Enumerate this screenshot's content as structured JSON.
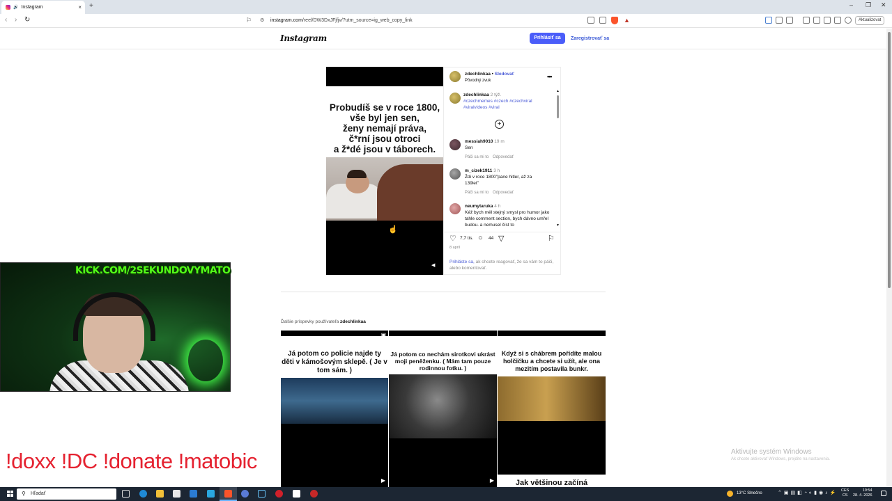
{
  "browser": {
    "tab_title": "Instagram",
    "tab_close": "×",
    "new_tab": "+",
    "url_host": "instagram.com",
    "url_rest": "/reel/DW3DxJFjfjv/?utm_source=ig_web_copy_link",
    "update_button": "Aktualizovat",
    "win_min": "–",
    "win_max": "❐",
    "win_close": "✕"
  },
  "instagram_header": {
    "logo": "Instagram",
    "login_button": "Prihlásiť sa",
    "signup_link": "Zaregistrovať sa"
  },
  "reel": {
    "caption_lines": [
      "Probudíš se v roce 1800,",
      "vše byl jen sen,",
      "ženy nemají práva,",
      "č*rní jsou otroci",
      "a ž*dé jsou v táborech."
    ]
  },
  "post": {
    "username": "zdechlinkaa",
    "separator": "•",
    "follow": "Sledovať",
    "audio": "Pôvodný zvuk",
    "more_icon": "•••",
    "caption_user": "zdechlinkaa",
    "caption_age": "2 týž.",
    "hashtags_line1": "#czechmemes #czech #czechviral",
    "hashtags_line2": "#viralvideos #viral",
    "like_count": "7,7 tis.",
    "comment_count": "44",
    "date": "8 apríl",
    "login_prompt_link": "Prihláste sa,",
    "login_prompt_rest": " ak chcete reagovať, že sa vám to páči, alebo komentovať."
  },
  "comments": [
    {
      "user": "messiah9010",
      "age": "19 m",
      "text": "Sen",
      "like": "Páči sa mi to",
      "reply": "Odpovedať"
    },
    {
      "user": "m_cizek1911",
      "age": "3 h",
      "text": "Ždi v roce 1800\"pane hitler, až za 139let\"",
      "like": "Páči sa mi to",
      "reply": "Odpovedať"
    },
    {
      "user": "neumytaruka",
      "age": "4 h",
      "text": "Kéž bych měl stejný smysl pro humor jako tahle comment section, bych dávno umřel budou. a nemusel číst to"
    }
  ],
  "more_posts": {
    "label": "Ďalšie príspevky používateľa",
    "user": "zdechlinkaa",
    "items": [
      {
        "caption": "Já potom co policie najde ty děti v kámošovým sklepě. ( Je v tom sám. )"
      },
      {
        "caption": "Já potom co nechám sirotkovi ukrást moji peněženku. ( Mám tam pouze rodinnou fotku. )"
      },
      {
        "caption": "Když si s chábrem pořídíte malou holčičku a chcete si užít, ale ona mezitím postavila bunkr."
      },
      {
        "caption": "Jak většinou začíná"
      }
    ]
  },
  "overlay": {
    "kick_label": "KICK.COM/2SEKUNDOVYMATO",
    "commands": "!doxx  !DC !donate !matobic"
  },
  "windows": {
    "activate_title": "Aktivujte systém Windows",
    "activate_sub": "Ak chcete aktivovať Windows, prejdite na nastavenia.",
    "search_placeholder": "Hľadať",
    "weather": "13°C  Slnečno",
    "lang_top": "CES",
    "lang_bottom": "CS",
    "time": "19:54",
    "date": "28. 4. 2026"
  },
  "colors": {
    "accent": "#4a5df9",
    "link": "#3b5ad6",
    "kick_green": "#53fc18",
    "command_red": "#e52230"
  }
}
